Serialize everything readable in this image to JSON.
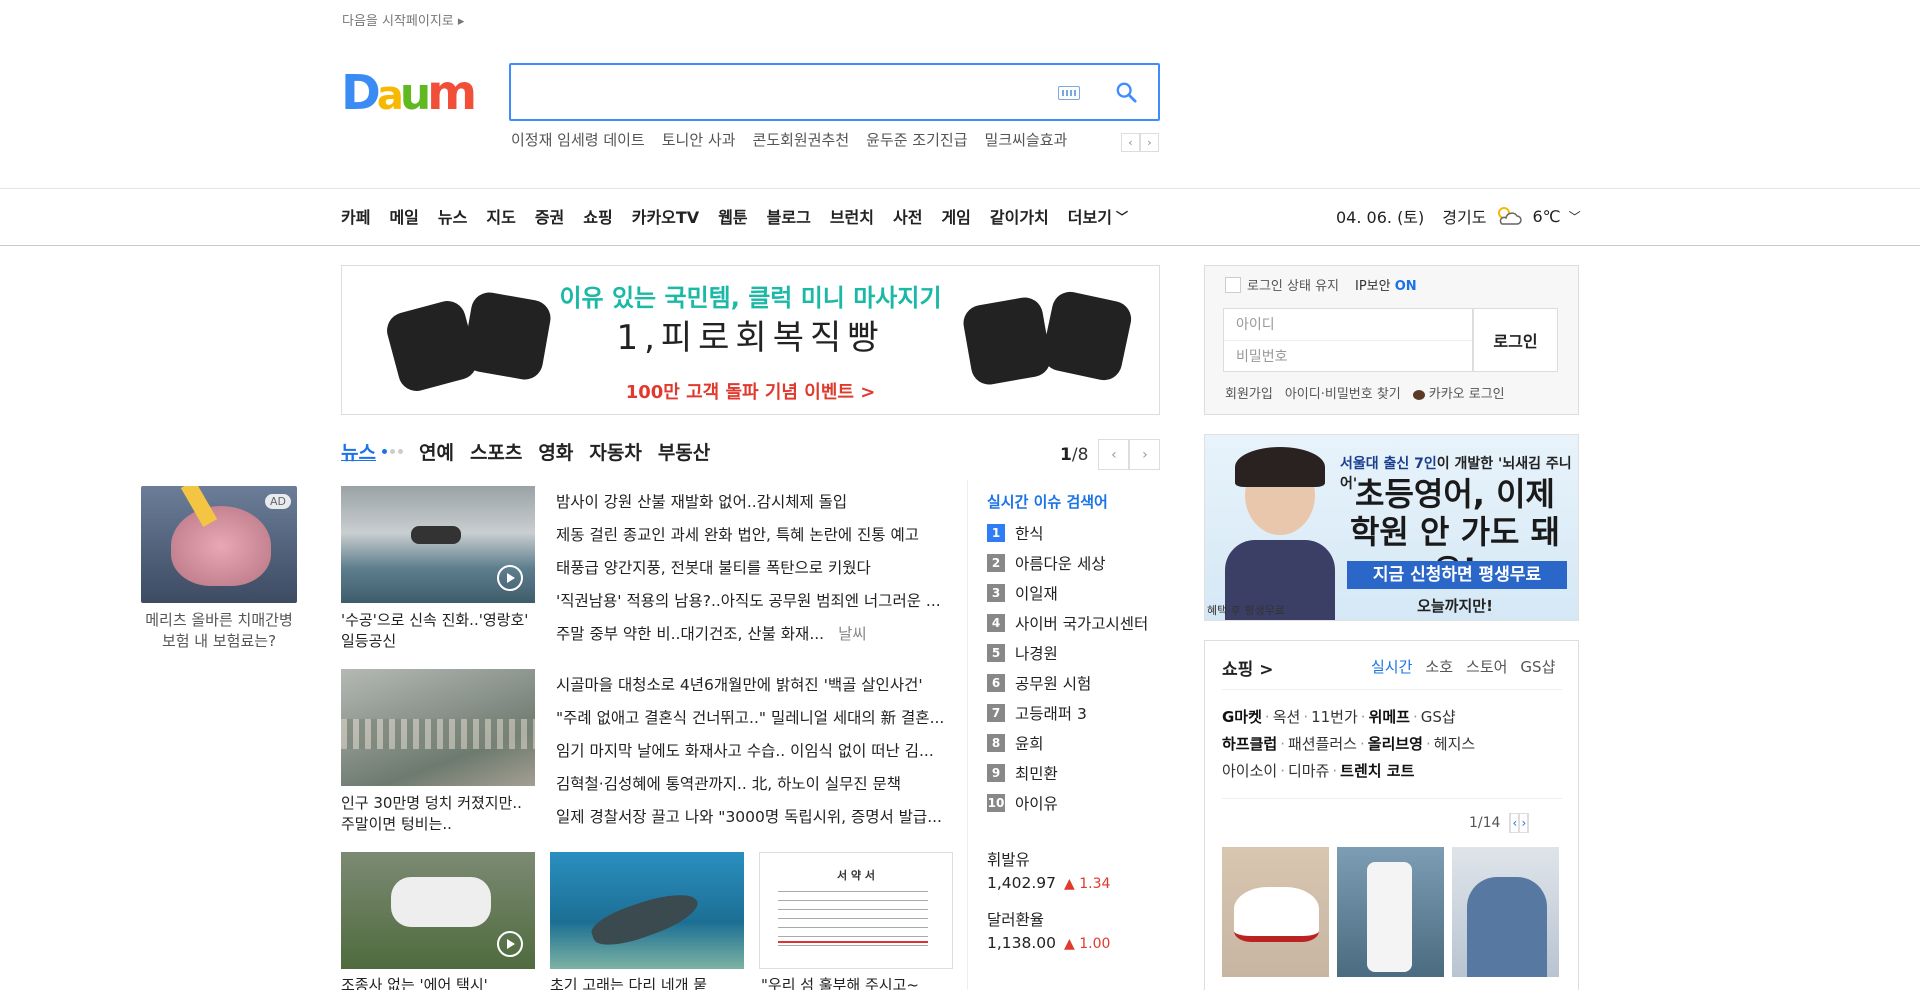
{
  "header": {
    "start_page": "다음을 시작페이지로",
    "logo": "Daum",
    "trends": [
      "이정재 임세령 데이트",
      "토니안 사과",
      "콘도회원권추천",
      "윤두준 조기진급",
      "밀크씨슬효과"
    ]
  },
  "nav": {
    "items": [
      "카페",
      "메일",
      "뉴스",
      "지도",
      "증권",
      "쇼핑",
      "카카오TV",
      "웹툰",
      "블로그",
      "브런치",
      "사전",
      "게임",
      "같이가치"
    ],
    "more": "더보기",
    "date": "04. 06. (토)",
    "region": "경기도",
    "temp": "6℃"
  },
  "banner": {
    "headline": "이유 있는 국민템, 클럭 미니 마사지기",
    "slogan": "1,피로회복직빵",
    "cta": "100만 고객 돌파 기념 이벤트 >"
  },
  "news": {
    "tabs": [
      "뉴스",
      "연예",
      "스포츠",
      "영화",
      "자동차",
      "부동산"
    ],
    "page_current": "1",
    "page_total": "/8",
    "ad_caption": "메리츠 올바른 치매간병보험 내 보험료는?",
    "ad_badge": "AD",
    "block1": {
      "caption": "'수공'으로 신속 진화..'영랑호' 일등공신",
      "items": [
        "밤사이 강원 산불 재발화 없어..감시체제 돌입",
        "제동 걸린 종교인 과세 완화 법안, 특혜 논란에 진통 예고",
        "태풍급 양간지풍, 전봇대 불티를 폭탄으로 키웠다",
        "'직권남용' 적용의 남용?..아직도 공무원 범죄엔 너그러운 ...",
        "주말 중부 약한 비..대기건조, 산불 화재..."
      ],
      "source": "날씨"
    },
    "block2": {
      "caption": "인구 30만명 덩치 커졌지만.. 주말이면 텅비는..",
      "items": [
        "시골마을 대청소로 4년6개월만에 밝혀진 '백골 살인사건'",
        "\"주례 없애고 결혼식 건너뛰고..\" 밀레니얼 세대의 新 결혼...",
        "임기 마지막 날에도 화재사고 수습.. 이임식 없이 떠난 김...",
        "김혁철·김성혜에 통역관까지.. 北, 하노이 실무진 문책",
        "일제 경찰서장 끌고 나와 \"3000명 독립시위, 증명서 발급..."
      ]
    },
    "bottom_captions": [
      "조종사 없는 '에어 택시'",
      "초기 고래는 다리 네개 뭍",
      "\"우리 섬 훌부해 주시고~"
    ],
    "doc_title": "서 약 서"
  },
  "realtime": {
    "title": "실시간 이슈 검색어",
    "items": [
      "한식",
      "아름다운 세상",
      "이일재",
      "사이버 국가고시센터",
      "나경원",
      "공무원 시험",
      "고등래퍼 3",
      "윤희",
      "최민환",
      "아이유"
    ]
  },
  "finance": [
    {
      "label": "휘발유",
      "value": "1,402.97",
      "change": "▲ 1.34"
    },
    {
      "label": "달러환율",
      "value": "1,138.00",
      "change": "▲ 1.00"
    }
  ],
  "login": {
    "keep": "로그인 상태 유지",
    "ip_label": "IP보안",
    "ip_state": "ON",
    "id_placeholder": "아이디",
    "pw_placeholder": "비밀번호",
    "button": "로그인",
    "links": [
      "회원가입",
      "아이디·비밀번호 찾기",
      "카카오 로그인"
    ]
  },
  "right_ad": {
    "line1a": "서울대 출신 7인",
    "line1b": "이 개발한 '뇌새김 주니어'",
    "line2": "초등영어, 이제",
    "line3": "학원 안 가도 돼요!",
    "cta": "지금 신청하면 평생무료",
    "sub": "오늘까지만!",
    "foot": "혜택 후 평생무료"
  },
  "shopping": {
    "title": "쇼핑 >",
    "tabs": [
      "실시간",
      "소호",
      "스토어",
      "GS샵"
    ],
    "row1": [
      "G마켓",
      "옥션",
      "11번가",
      "위메프",
      "GS샵"
    ],
    "row2": [
      "하프클럽",
      "패션플러스",
      "올리브영",
      "헤지스"
    ],
    "row3": [
      "아이소이",
      "디마쥬",
      "트렌치 코트"
    ],
    "page": "1/14"
  },
  "colors": {
    "accent": "#1a73e8",
    "logo_blue": "#3b8bf5",
    "logo_yellow": "#f6b900",
    "logo_green": "#60b920",
    "logo_red": "#f14f38"
  }
}
